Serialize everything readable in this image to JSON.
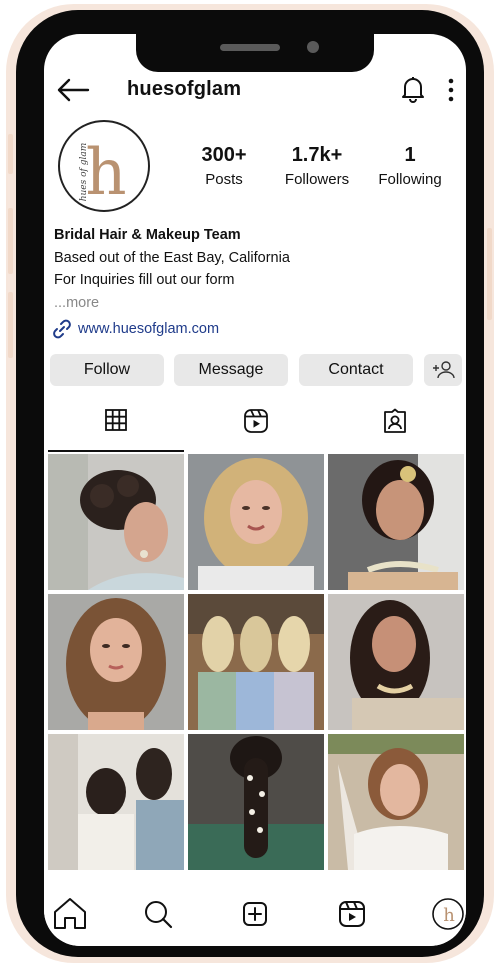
{
  "profile": {
    "username": "huesofglam",
    "logo_letter": "h",
    "logo_script": "hues of glam",
    "stats": [
      {
        "value": "300+",
        "label": "Posts"
      },
      {
        "value": "1.7k+",
        "label": "Followers"
      },
      {
        "value": "1",
        "label": "Following"
      }
    ],
    "bio": {
      "name": "Bridal Hair & Makeup Team",
      "line1": "Based out of the East Bay, California",
      "line2": "For Inquiries fill out our form",
      "more": "...more"
    },
    "link": "www.huesofglam.com"
  },
  "actions": {
    "follow": "Follow",
    "message": "Message",
    "contact": "Contact"
  },
  "tabs": [
    "grid-icon",
    "reels-icon",
    "tagged-icon"
  ],
  "posts": [
    "updo-bride-photo",
    "blonde-waves-photo",
    "indian-bride-photo",
    "brunette-waves-photo",
    "bridesmaids-photo",
    "sari-bride-photo",
    "getting-ready-photo",
    "braided-hair-photo",
    "veil-bride-photo"
  ],
  "bottom_nav": [
    "home-icon",
    "search-icon",
    "create-icon",
    "reels-icon",
    "profile-avatar"
  ],
  "colors": {
    "brand_tan": "#b99271",
    "link": "#1f3b8a",
    "button_bg": "#e8e8e8",
    "frame_blush": "#f6e6dc"
  }
}
